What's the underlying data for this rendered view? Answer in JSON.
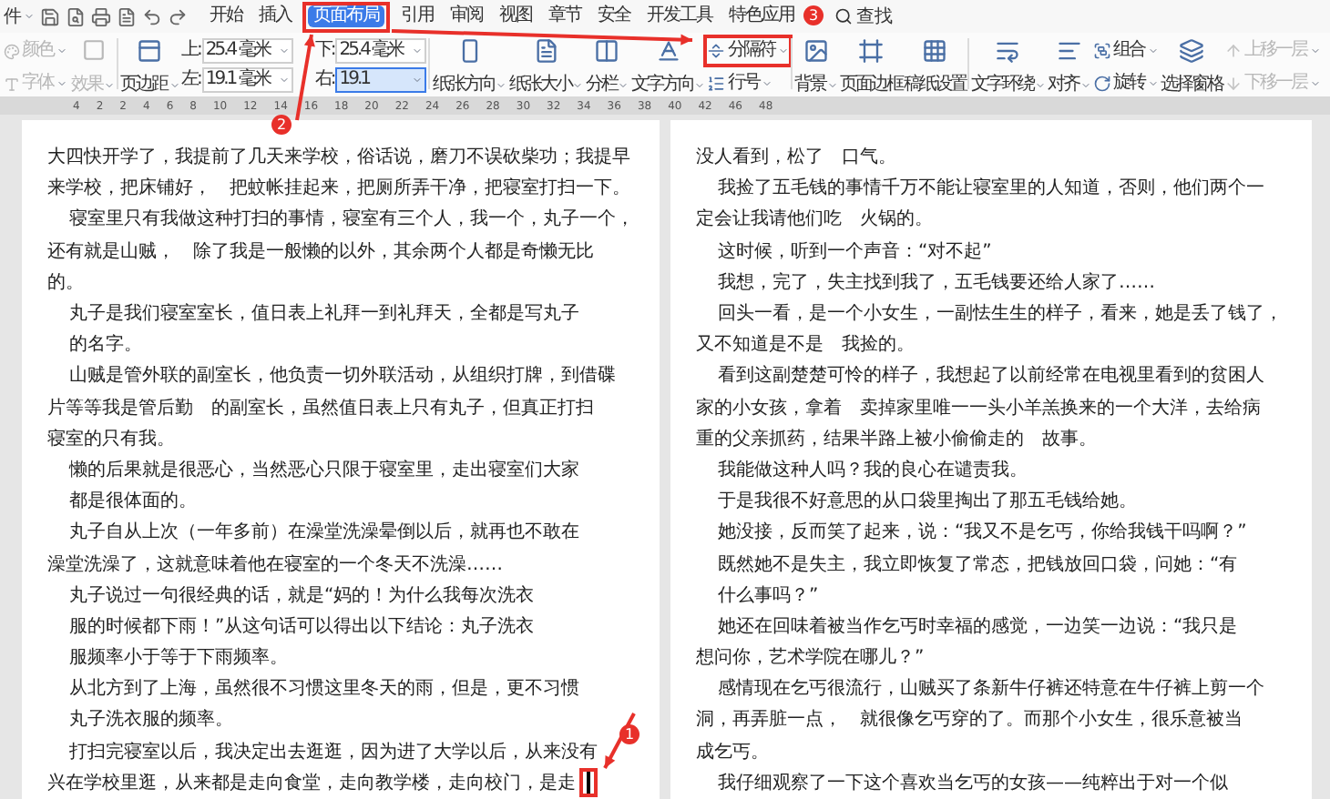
{
  "menu": {
    "app_menu": "件",
    "tabs": [
      {
        "label": "开始",
        "selected": false
      },
      {
        "label": "插入",
        "selected": false
      },
      {
        "label": "页面布局",
        "selected": true
      },
      {
        "label": "引用",
        "selected": false
      },
      {
        "label": "审阅",
        "selected": false
      },
      {
        "label": "视图",
        "selected": false
      },
      {
        "label": "章节",
        "selected": false
      },
      {
        "label": "安全",
        "selected": false
      },
      {
        "label": "开发工具",
        "selected": false
      },
      {
        "label": "特色应用",
        "selected": false
      }
    ],
    "search": "查找"
  },
  "ribbon": {
    "theme": [
      {
        "label": "颜色",
        "disabled": true
      },
      {
        "label": "字体",
        "disabled": true
      },
      {
        "label": "效果",
        "disabled": true
      }
    ],
    "margins_button": "页边距",
    "margins": [
      {
        "label": "上:",
        "value": "25.4 毫米",
        "focused": false
      },
      {
        "label": "下:",
        "value": "25.4 毫米",
        "focused": false
      },
      {
        "label": "左:",
        "value": "19.1 毫米",
        "focused": false
      },
      {
        "label": "右:",
        "value": "19.1",
        "focused": true
      }
    ],
    "groups": [
      {
        "kind": "large",
        "label": "纸张方向",
        "dropdown": true
      },
      {
        "kind": "large",
        "label": "纸张大小",
        "dropdown": true
      },
      {
        "kind": "large",
        "label": "分栏",
        "dropdown": true
      },
      {
        "kind": "large",
        "label": "文字方向",
        "dropdown": true
      },
      {
        "kind": "stack",
        "items": [
          {
            "label": "分隔符",
            "dropdown": true,
            "disabled": false
          },
          {
            "label": "行号",
            "dropdown": true,
            "disabled": false
          }
        ]
      },
      {
        "kind": "large",
        "label": "背景",
        "dropdown": true
      },
      {
        "kind": "large",
        "label": "页面边框",
        "dropdown": false
      },
      {
        "kind": "large",
        "label": "稿纸设置",
        "dropdown": false
      },
      {
        "kind": "large",
        "label": "文字环绕",
        "dropdown": true
      },
      {
        "kind": "large",
        "label": "对齐",
        "dropdown": true
      },
      {
        "kind": "stack",
        "items": [
          {
            "label": "组合",
            "dropdown": true,
            "disabled": false
          },
          {
            "label": "旋转",
            "dropdown": true,
            "disabled": false
          }
        ]
      },
      {
        "kind": "large",
        "label": "选择窗格",
        "dropdown": false
      },
      {
        "kind": "stack",
        "items": [
          {
            "label": "上移一层",
            "dropdown": true,
            "disabled": true
          },
          {
            "label": "下移一层",
            "dropdown": true,
            "disabled": true
          }
        ]
      }
    ]
  },
  "ruler": [
    "4",
    "2",
    "2",
    "4",
    "6",
    "8",
    "10",
    "12",
    "14",
    "16",
    "18",
    "20",
    "22",
    "24",
    "26",
    "28",
    "30",
    "32",
    "34",
    "36",
    "38",
    "40",
    "42",
    "46",
    "48"
  ],
  "pages": [
    {
      "lines": [
        {
          "kind": "flush",
          "text": "大四快开学了，我提前了几天来学校，俗话说，磨刀不误砍柴功；我提早"
        },
        {
          "kind": "flush",
          "text": "来学校，把床铺好，　把蚊帐挂起来，把厕所弄干净，把寝室打扫一下。"
        },
        {
          "kind": "indent",
          "text": "寝室里只有我做这种打扫的事情，寝室有三个人，我一个，丸子一个，"
        },
        {
          "kind": "flush",
          "text": "还有就是山贼，　除了我是一般懒的以外，其余两个人都是奇懒无比"
        },
        {
          "kind": "flush",
          "text": "的。"
        },
        {
          "kind": "indent",
          "text": "丸子是我们寝室室长，值日表上礼拜一到礼拜天，全都是写丸子"
        },
        {
          "kind": "indent",
          "text": "的名字。"
        },
        {
          "kind": "indent",
          "text": "山贼是管外联的副室长，他负责一切外联活动，从组织打牌，到借碟"
        },
        {
          "kind": "flush",
          "text": "片等等我是管后勤　的副室长，虽然值日表上只有丸子，但真正打扫"
        },
        {
          "kind": "flush",
          "text": "寝室的只有我。"
        },
        {
          "kind": "indent",
          "text": "懒的后果就是很恶心，当然恶心只限于寝室里，走出寝室们大家"
        },
        {
          "kind": "indent",
          "text": "都是很体面的。"
        },
        {
          "kind": "indent",
          "text": "丸子自从上次（一年多前）在澡堂洗澡晕倒以后，就再也不敢在"
        },
        {
          "kind": "flush",
          "text": "澡堂洗澡了，这就意味着他在寝室的一个冬天不洗澡……"
        },
        {
          "kind": "indent",
          "text": "丸子说过一句很经典的话，就是“妈的！为什么我每次洗衣"
        },
        {
          "kind": "indent",
          "text": "服的时候都下雨！”从这句话可以得出以下结论：丸子洗衣"
        },
        {
          "kind": "indent",
          "text": "服频率小于等于下雨频率。"
        },
        {
          "kind": "indent",
          "text": "从北方到了上海，虽然很不习惯这里冬天的雨，但是，更不习惯"
        },
        {
          "kind": "indent",
          "text": "丸子洗衣服的频率。"
        },
        {
          "kind": "indent",
          "text": "打扫完寝室以后，我决定出去逛逛，因为进了大学以后，从来没有"
        },
        {
          "kind": "flush",
          "text": "兴在学校里逛，从来都是走向食堂，走向教学楼，走向校门，是走"
        }
      ]
    },
    {
      "lines": [
        {
          "kind": "flush",
          "text": "没人看到，松了　口气。"
        },
        {
          "kind": "indent",
          "text": "我捡了五毛钱的事情千万不能让寝室里的人知道，否则，他们两个一"
        },
        {
          "kind": "flush",
          "text": "定会让我请他们吃　火锅的。"
        },
        {
          "kind": "indent",
          "text": "这时候，听到一个声音：“对不起”"
        },
        {
          "kind": "indent",
          "text": "我想，完了，失主找到我了，五毛钱要还给人家了……"
        },
        {
          "kind": "indent",
          "text": "回头一看，是一个小女生，一副怯生生的样子，看来，她是丢了钱了，"
        },
        {
          "kind": "flush",
          "text": "又不知道是不是　我捡的。"
        },
        {
          "kind": "indent",
          "text": "看到这副楚楚可怜的样子，我想起了以前经常在电视里看到的贫困人"
        },
        {
          "kind": "flush",
          "text": "家的小女孩，拿着　卖掉家里唯一一头小羊羔换来的一个大洋，去给病"
        },
        {
          "kind": "flush",
          "text": "重的父亲抓药，结果半路上被小偷偷走的　故事。"
        },
        {
          "kind": "indent",
          "text": "我能做这种人吗？我的良心在谴责我。"
        },
        {
          "kind": "indent",
          "text": "于是我很不好意思的从口袋里掏出了那五毛钱给她。"
        },
        {
          "kind": "indent",
          "text": "她没接，反而笑了起来，说：“我又不是乞丐，你给我钱干吗啊？”"
        },
        {
          "kind": "indent",
          "text": "既然她不是失主，我立即恢复了常态，把钱放回口袋，问她：“有"
        },
        {
          "kind": "indent",
          "text": "什么事吗？”"
        },
        {
          "kind": "indent",
          "text": "她还在回味着被当作乞丐时幸福的感觉，一边笑一边说：“我只是"
        },
        {
          "kind": "flush",
          "text": "想问你，艺术学院在哪儿？”"
        },
        {
          "kind": "indent",
          "text": "感情现在乞丐很流行，山贼买了条新牛仔裤还特意在牛仔裤上剪一个"
        },
        {
          "kind": "flush",
          "text": "洞，再弄脏一点，　就很像乞丐穿的了。而那个小女生，很乐意被当"
        },
        {
          "kind": "flush",
          "text": "成乞丐。"
        },
        {
          "kind": "indent",
          "text": "我仔细观察了一下这个喜欢当乞丐的女孩——纯粹出于对一个似"
        }
      ]
    }
  ],
  "callouts": [
    {
      "number": "1"
    },
    {
      "number": "2"
    },
    {
      "number": "3"
    }
  ]
}
